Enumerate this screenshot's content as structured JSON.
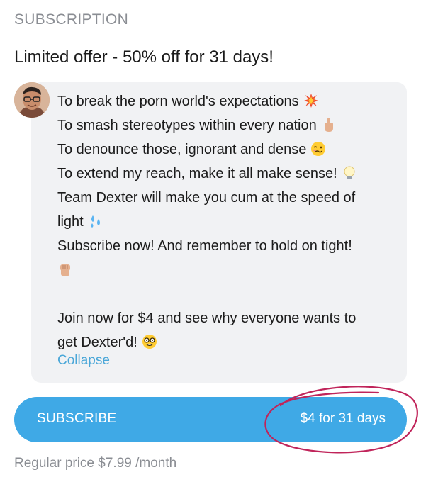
{
  "section": {
    "label": "SUBSCRIPTION"
  },
  "offer": {
    "title": "Limited offer - 50% off for 31 days!"
  },
  "message": {
    "lines": [
      {
        "text": "To break the porn world's expectations",
        "icon": "collision-icon"
      },
      {
        "text": "To smash stereotypes within every nation",
        "icon": "middle-finger-icon"
      },
      {
        "text": "To denounce those, ignorant and dense",
        "icon": "woozy-face-icon"
      },
      {
        "text": "To extend my reach, make it all make sense!",
        "icon": "light-bulb-icon"
      },
      {
        "text": "Team Dexter will make you cum at the speed of",
        "icon": ""
      },
      {
        "text": "light",
        "icon": "sweat-droplets-icon"
      },
      {
        "text": "Subscribe now! And remember to hold on tight!",
        "icon": ""
      },
      {
        "text": "",
        "icon": "raised-fist-icon"
      },
      {
        "text": "",
        "icon": ""
      },
      {
        "text": "Join now for $4 and see why everyone wants to",
        "icon": ""
      },
      {
        "text": "get Dexter'd!",
        "icon": "nerd-face-icon"
      }
    ],
    "collapse_label": "Collapse"
  },
  "subscribe": {
    "label": "SUBSCRIBE",
    "price": "$4 for 31 days"
  },
  "regular_price": "Regular price $7.99 /month",
  "colors": {
    "accent": "#3fa9e6",
    "link": "#4aa7d8",
    "annotation": "#c0245a",
    "muted": "#8a8d93"
  }
}
